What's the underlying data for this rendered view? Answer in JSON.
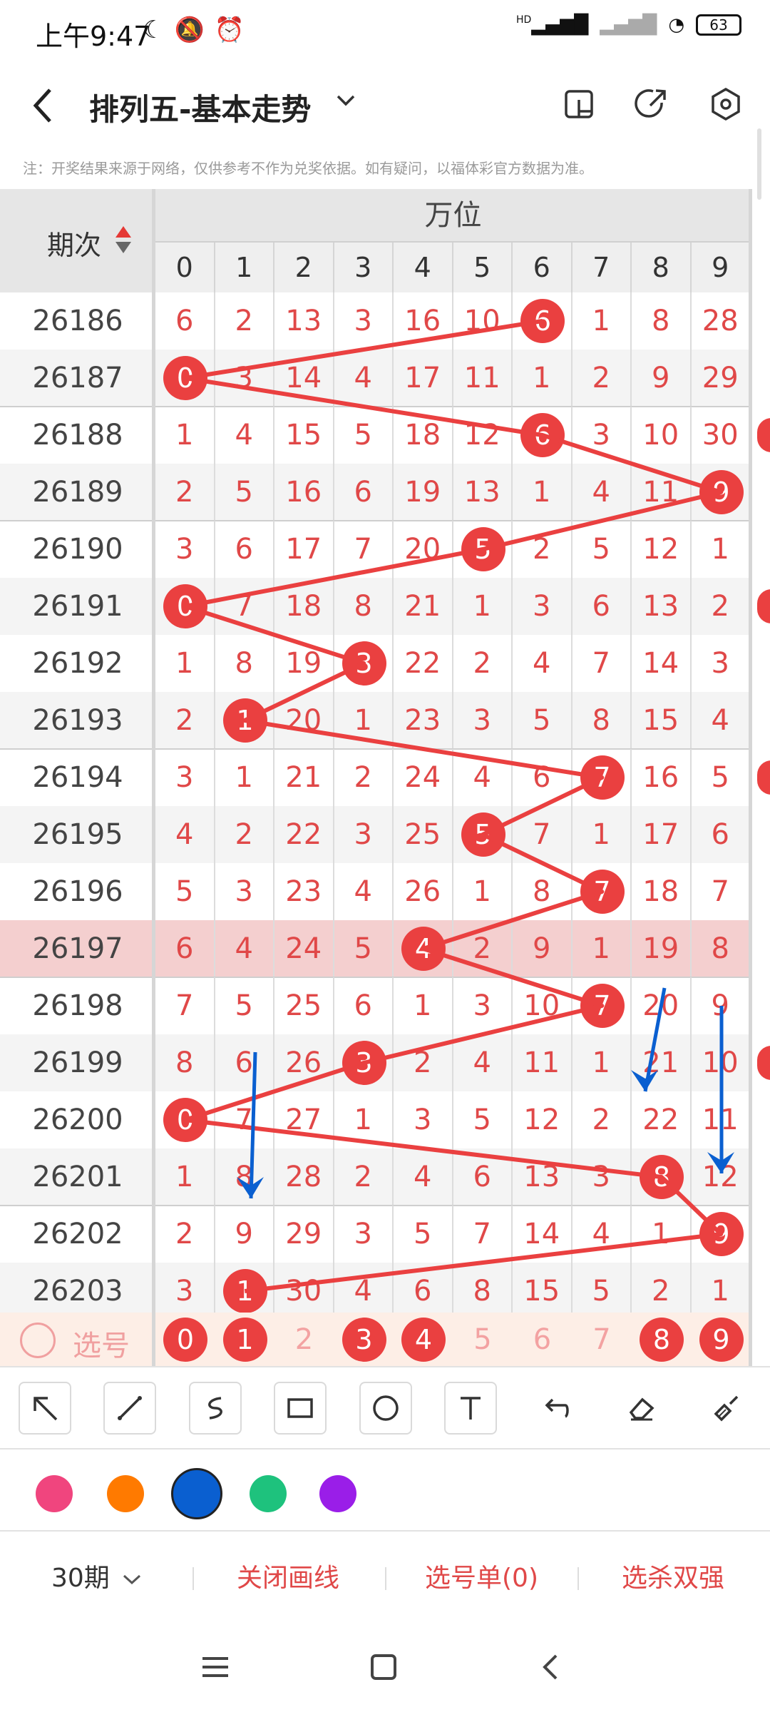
{
  "status_bar": {
    "time": "上午9:47",
    "battery": "63",
    "network_label": "HD"
  },
  "header": {
    "title": "排列五-基本走势",
    "back_icon": "back-arrow-icon",
    "icons": [
      "split-view-icon",
      "share-icon",
      "settings-icon"
    ]
  },
  "notice": "注：开奖结果来源于网络，仅供参考不作为兑奖依据。如有疑问，以福体彩官方数据为准。",
  "table": {
    "period_header": "期次",
    "group_header": "万位",
    "digits": [
      "0",
      "1",
      "2",
      "3",
      "4",
      "5",
      "6",
      "7",
      "8",
      "9"
    ],
    "rows": [
      {
        "period": "26186",
        "cells": [
          "6",
          "2",
          "13",
          "3",
          "16",
          "10",
          "6",
          "1",
          "8",
          "28"
        ],
        "hit": 6
      },
      {
        "period": "26187",
        "cells": [
          "0",
          "3",
          "14",
          "4",
          "17",
          "11",
          "1",
          "2",
          "9",
          "29"
        ],
        "hit": 0
      },
      {
        "period": "26188",
        "cells": [
          "1",
          "4",
          "15",
          "5",
          "18",
          "12",
          "6",
          "3",
          "10",
          "30"
        ],
        "hit": 6
      },
      {
        "period": "26189",
        "cells": [
          "2",
          "5",
          "16",
          "6",
          "19",
          "13",
          "1",
          "4",
          "11",
          "9"
        ],
        "hit": 9
      },
      {
        "period": "26190",
        "cells": [
          "3",
          "6",
          "17",
          "7",
          "20",
          "5",
          "2",
          "5",
          "12",
          "1"
        ],
        "hit": 5
      },
      {
        "period": "26191",
        "cells": [
          "0",
          "7",
          "18",
          "8",
          "21",
          "1",
          "3",
          "6",
          "13",
          "2"
        ],
        "hit": 0
      },
      {
        "period": "26192",
        "cells": [
          "1",
          "8",
          "19",
          "3",
          "22",
          "2",
          "4",
          "7",
          "14",
          "3"
        ],
        "hit": 3
      },
      {
        "period": "26193",
        "cells": [
          "2",
          "1",
          "20",
          "1",
          "23",
          "3",
          "5",
          "8",
          "15",
          "4"
        ],
        "hit": 1
      },
      {
        "period": "26194",
        "cells": [
          "3",
          "1",
          "21",
          "2",
          "24",
          "4",
          "6",
          "7",
          "16",
          "5"
        ],
        "hit": 7
      },
      {
        "period": "26195",
        "cells": [
          "4",
          "2",
          "22",
          "3",
          "25",
          "5",
          "7",
          "1",
          "17",
          "6"
        ],
        "hit": 5
      },
      {
        "period": "26196",
        "cells": [
          "5",
          "3",
          "23",
          "4",
          "26",
          "1",
          "8",
          "7",
          "18",
          "7"
        ],
        "hit": 7
      },
      {
        "period": "26197",
        "cells": [
          "6",
          "4",
          "24",
          "5",
          "4",
          "2",
          "9",
          "1",
          "19",
          "8"
        ],
        "hit": 4
      },
      {
        "period": "26198",
        "cells": [
          "7",
          "5",
          "25",
          "6",
          "1",
          "3",
          "10",
          "7",
          "20",
          "9"
        ],
        "hit": 7
      },
      {
        "period": "26199",
        "cells": [
          "8",
          "6",
          "26",
          "3",
          "2",
          "4",
          "11",
          "1",
          "21",
          "10"
        ],
        "hit": 3
      },
      {
        "period": "26200",
        "cells": [
          "0",
          "7",
          "27",
          "1",
          "3",
          "5",
          "12",
          "2",
          "22",
          "11"
        ],
        "hit": 0
      },
      {
        "period": "26201",
        "cells": [
          "1",
          "8",
          "28",
          "2",
          "4",
          "6",
          "13",
          "3",
          "8",
          "12"
        ],
        "hit": 8
      },
      {
        "period": "26202",
        "cells": [
          "2",
          "9",
          "29",
          "3",
          "5",
          "7",
          "14",
          "4",
          "1",
          "9"
        ],
        "hit": 9
      },
      {
        "period": "26203",
        "cells": [
          "3",
          "1",
          "30",
          "4",
          "6",
          "8",
          "15",
          "5",
          "2",
          "1"
        ],
        "hit": 1
      }
    ],
    "highlight_row": "26197",
    "selector": {
      "label": "选号",
      "numbers": [
        "0",
        "1",
        "2",
        "3",
        "4",
        "5",
        "6",
        "7",
        "8",
        "9"
      ],
      "selected": [
        0,
        1,
        3,
        4,
        8,
        9
      ]
    }
  },
  "draw_tools": [
    "arrow-tool-icon",
    "line-tool-icon",
    "freehand-tool-icon",
    "rectangle-tool-icon",
    "circle-tool-icon",
    "text-tool-icon",
    "undo-icon",
    "eraser-icon",
    "clear-brush-icon"
  ],
  "colors": [
    "#f0457e",
    "#ff7a00",
    "#0a5fd0",
    "#1ec27d",
    "#9a1ee8"
  ],
  "selected_color": "#0a5fd0",
  "bottom_bar": {
    "periods": "30期",
    "close_lines": "关闭画线",
    "pick_list": "选号单(0)",
    "kill_select": "选杀双强"
  },
  "accent_color": "#ea4040"
}
